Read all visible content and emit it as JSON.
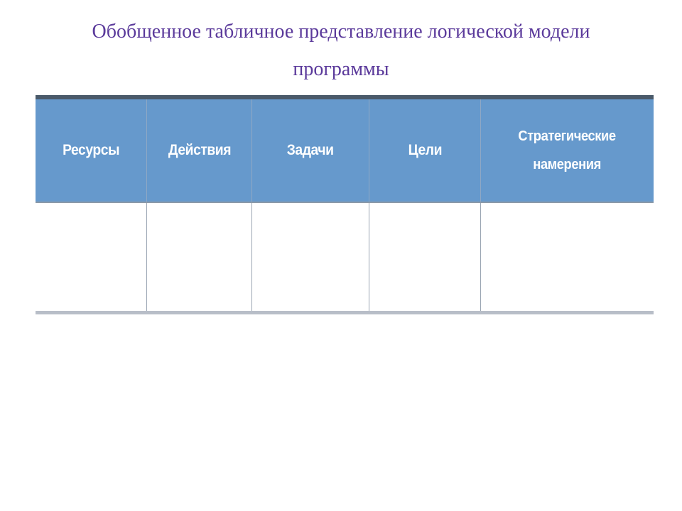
{
  "title": "Обобщенное табличное представление логической модели программы",
  "table": {
    "headers": [
      "Ресурсы",
      "Действия",
      "Задачи",
      "Цели",
      "Стратегические намерения"
    ],
    "cells": [
      "",
      "",
      "",
      "",
      ""
    ]
  },
  "colors": {
    "header_bg": "#6699cc",
    "header_text": "#ffffff",
    "title_text": "#5b3a9b",
    "border": "#9aa5b3"
  }
}
